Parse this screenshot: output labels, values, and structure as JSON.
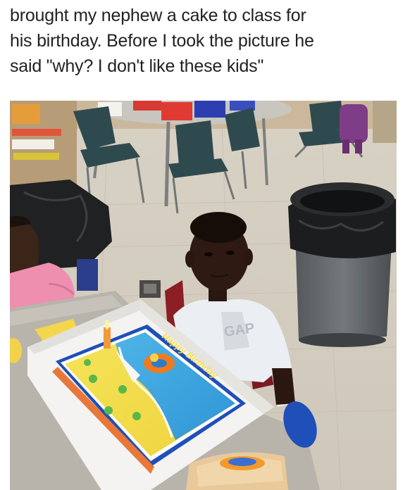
{
  "caption": {
    "lines": [
      "brought my nephew a cake to class for",
      "his birthday. Before I took the picture he",
      "said \"why? I don't like these kids\""
    ]
  },
  "photo": {
    "cake_text": "Happy Birthday"
  }
}
